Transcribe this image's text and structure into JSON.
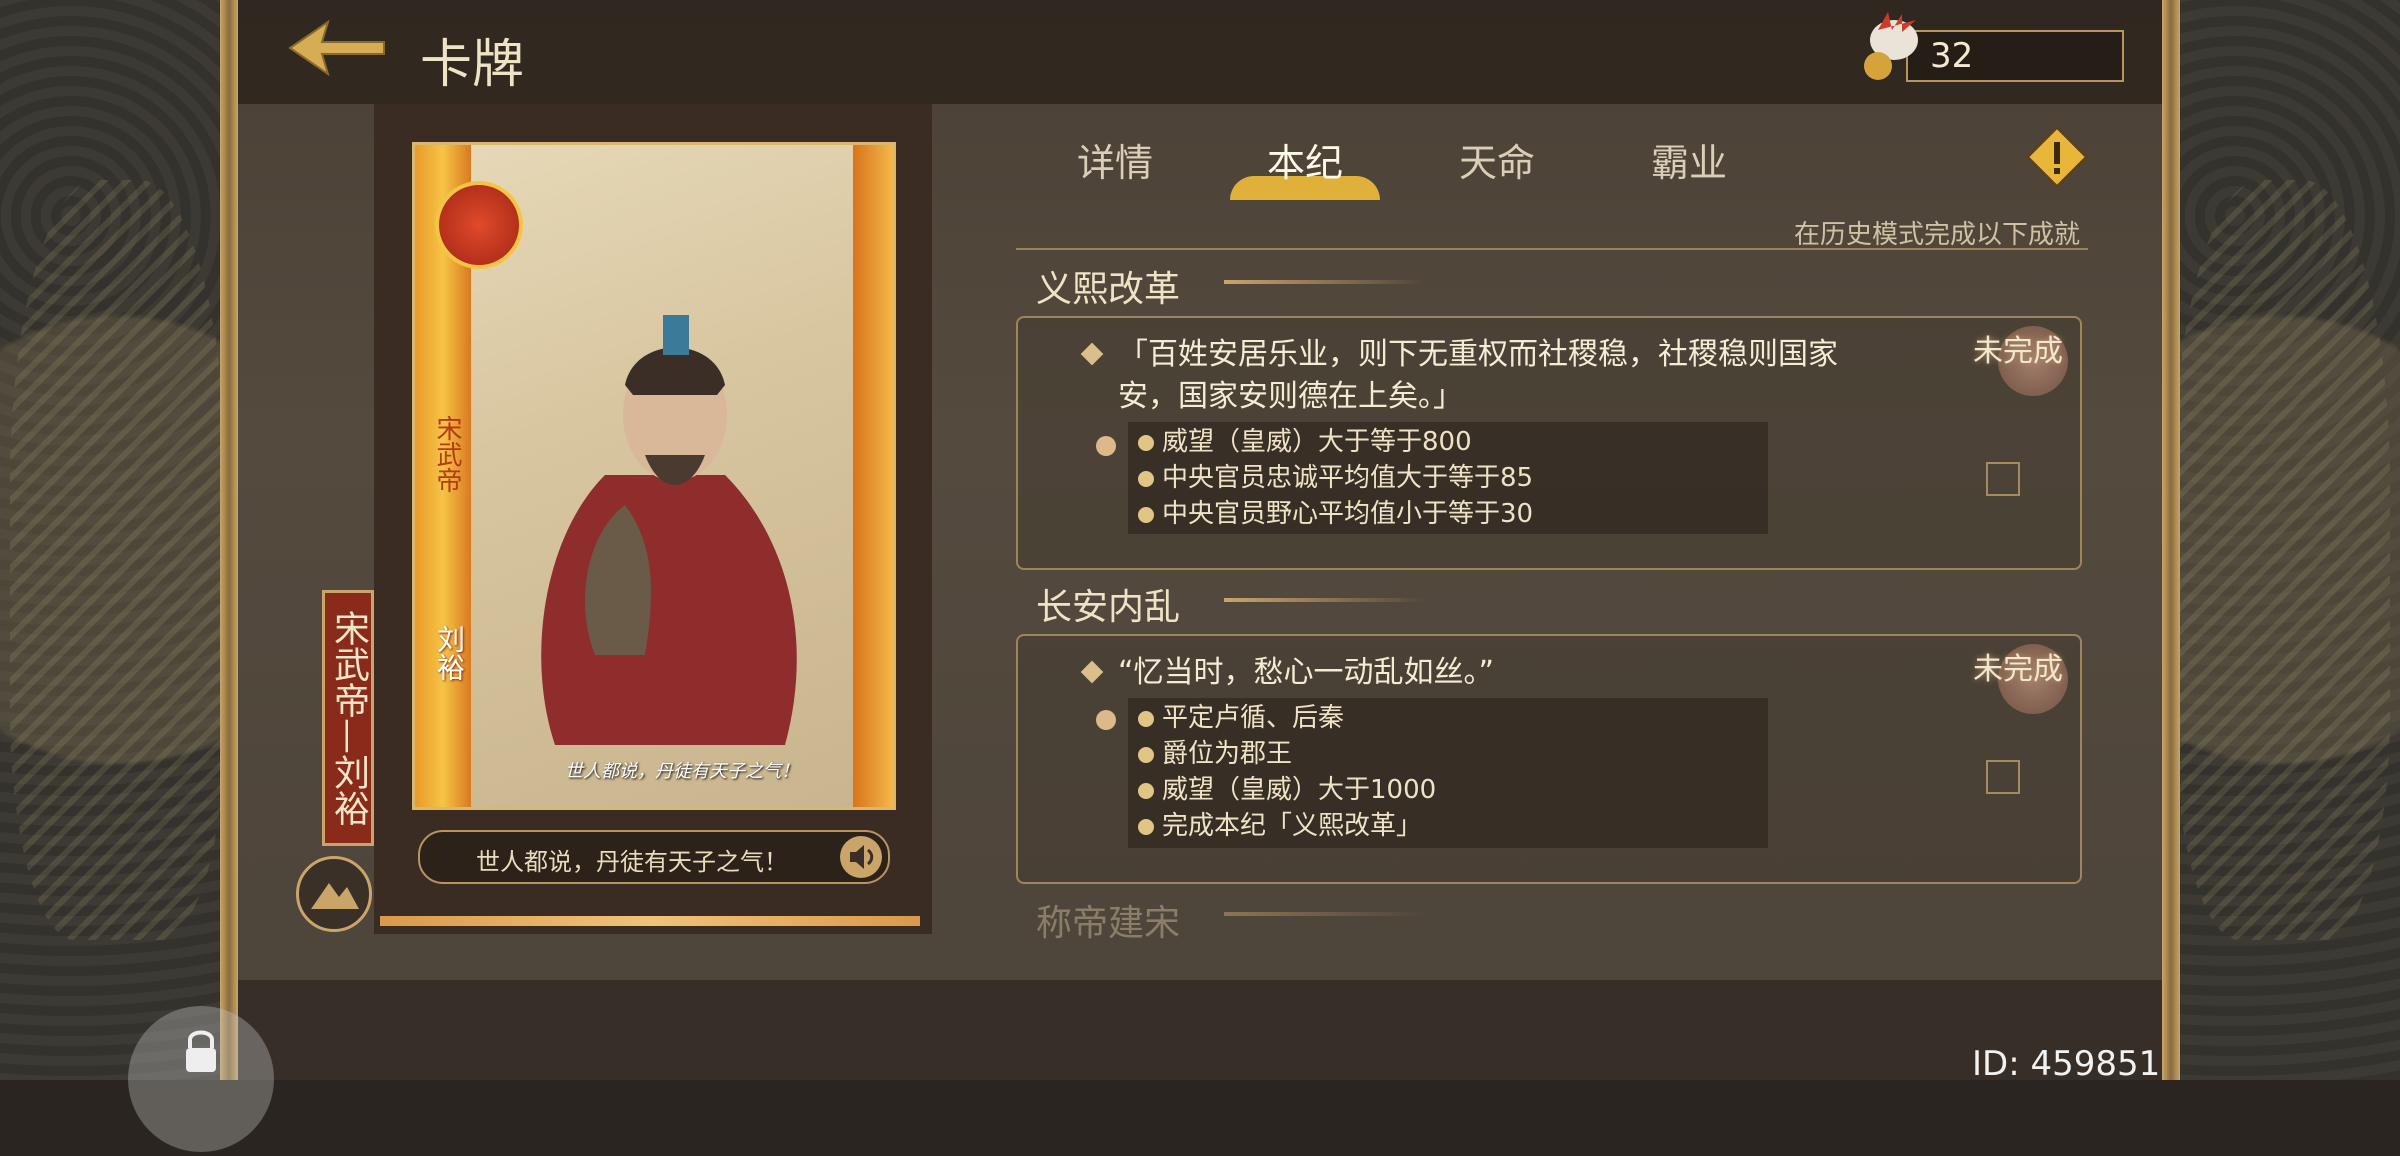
{
  "header": {
    "title": "卡牌",
    "resource_count": "32"
  },
  "card": {
    "banner_name": "宋武帝—刘裕",
    "emperor_title": "宋武帝",
    "name_on_card": "刘裕",
    "card_caption": "世人都说，丹徒有天子之气！",
    "quote_line": "世人都说，丹徒有天子之气！"
  },
  "tabs": [
    {
      "label": "详情",
      "active": false
    },
    {
      "label": "本纪",
      "active": true
    },
    {
      "label": "天命",
      "active": false
    },
    {
      "label": "霸业",
      "active": false
    }
  ],
  "subtitle": "在历史模式完成以下成就",
  "sections": [
    {
      "title": "义熙改革",
      "quote_line1": "「百姓安居乐业，则下无重权而社稷稳，社稷稳则国家",
      "quote_line2": "安，国家安则德在上矣。」",
      "status": "未完成",
      "conditions": [
        "威望（皇威）大于等于800",
        "中央官员忠诚平均值大于等于85",
        "中央官员野心平均值小于等于30"
      ]
    },
    {
      "title": "长安内乱",
      "quote_line1": "“忆当时，愁心一动乱如丝。”",
      "status": "未完成",
      "conditions": [
        "平定卢循、后秦",
        "爵位为郡王",
        "威望（皇威）大于1000",
        "完成本纪「义熙改革」"
      ]
    },
    {
      "title": "称帝建宋"
    }
  ],
  "footer": {
    "id_label": "ID: 459851"
  },
  "colors": {
    "accent": "#c9a56a",
    "active_tab_glow": "#f0be3c",
    "panel_border": "#9e855b"
  }
}
